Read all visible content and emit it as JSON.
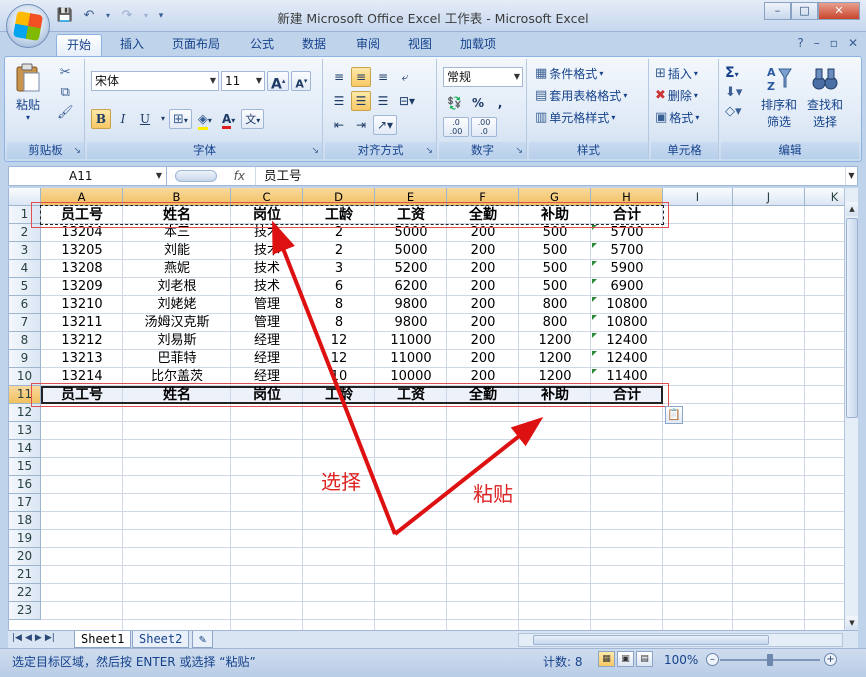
{
  "window": {
    "title": "新建 Microsoft Office Excel 工作表 - Microsoft Excel",
    "controls": [
      "–",
      "□",
      "✕"
    ]
  },
  "ribbon_tabs": [
    "开始",
    "插入",
    "页面布局",
    "公式",
    "数据",
    "审阅",
    "视图",
    "加载项"
  ],
  "ribbon": {
    "clipboard": {
      "label": "剪贴板",
      "paste": "粘贴"
    },
    "font": {
      "label": "字体",
      "name": "宋体",
      "size": "11",
      "bold": "B",
      "italic": "I",
      "underline": "U",
      "grow": "A",
      "shrink": "A",
      "color_letter": "A",
      "phonetic": "文"
    },
    "alignment": {
      "label": "对齐方式"
    },
    "number": {
      "label": "数字",
      "format": "常规",
      "percent": "%",
      "comma": ",",
      "inc": ".0 .00",
      "dec": ".00 .0"
    },
    "styles": {
      "label": "样式",
      "conditional": "条件格式",
      "table": "套用表格格式",
      "cell_styles": "单元格样式"
    },
    "cells": {
      "label": "单元格",
      "insert": "插入",
      "delete": "删除",
      "format": "格式"
    },
    "editing": {
      "label": "编辑",
      "sum": "Σ",
      "sort_filter_1": "排序和",
      "sort_filter_2": "筛选",
      "find_1": "查找和",
      "find_2": "选择"
    }
  },
  "formula_bar": {
    "name_box": "A11",
    "fx": "fx",
    "content": "员工号"
  },
  "grid": {
    "columns": [
      "A",
      "B",
      "C",
      "D",
      "E",
      "F",
      "G",
      "H",
      "I",
      "J",
      "K"
    ],
    "rows": [
      "1",
      "2",
      "3",
      "4",
      "5",
      "6",
      "7",
      "8",
      "9",
      "10",
      "11",
      "12",
      "13",
      "14",
      "15",
      "16",
      "17",
      "18",
      "19",
      "20",
      "21",
      "22",
      "23"
    ],
    "header": [
      "员工号",
      "姓名",
      "岗位",
      "工龄",
      "工资",
      "全勤",
      "补助",
      "合计"
    ],
    "data": [
      [
        "13204",
        "本三",
        "技术",
        "2",
        "5000",
        "200",
        "500",
        "5700"
      ],
      [
        "13205",
        "刘能",
        "技术",
        "2",
        "5000",
        "200",
        "500",
        "5700"
      ],
      [
        "13208",
        "燕妮",
        "技术",
        "3",
        "5200",
        "200",
        "500",
        "5900"
      ],
      [
        "13209",
        "刘老根",
        "技术",
        "6",
        "6200",
        "200",
        "500",
        "6900"
      ],
      [
        "13210",
        "刘姥姥",
        "管理",
        "8",
        "9800",
        "200",
        "800",
        "10800"
      ],
      [
        "13211",
        "汤姆汉克斯",
        "管理",
        "8",
        "9800",
        "200",
        "800",
        "10800"
      ],
      [
        "13212",
        "刘易斯",
        "经理",
        "12",
        "11000",
        "200",
        "1200",
        "12400"
      ],
      [
        "13213",
        "巴菲特",
        "经理",
        "12",
        "11000",
        "200",
        "1200",
        "12400"
      ],
      [
        "13214",
        "比尔盖茨",
        "经理",
        "10",
        "10000",
        "200",
        "1200",
        "11400"
      ]
    ],
    "pasted_header": [
      "员工号",
      "姓名",
      "岗位",
      "工龄",
      "工资",
      "全勤",
      "补助",
      "合计"
    ]
  },
  "annotations": {
    "select": "选择",
    "paste": "粘贴"
  },
  "sheets": [
    "Sheet1",
    "Sheet2"
  ],
  "status": {
    "message": "选定目标区域，然后按 ENTER 或选择 “粘贴”",
    "count": "计数: 8",
    "zoom": "100%"
  },
  "colors": {
    "accent": "#15428b",
    "arrow": "#dd1111",
    "selected_header": "#f1c15f"
  }
}
